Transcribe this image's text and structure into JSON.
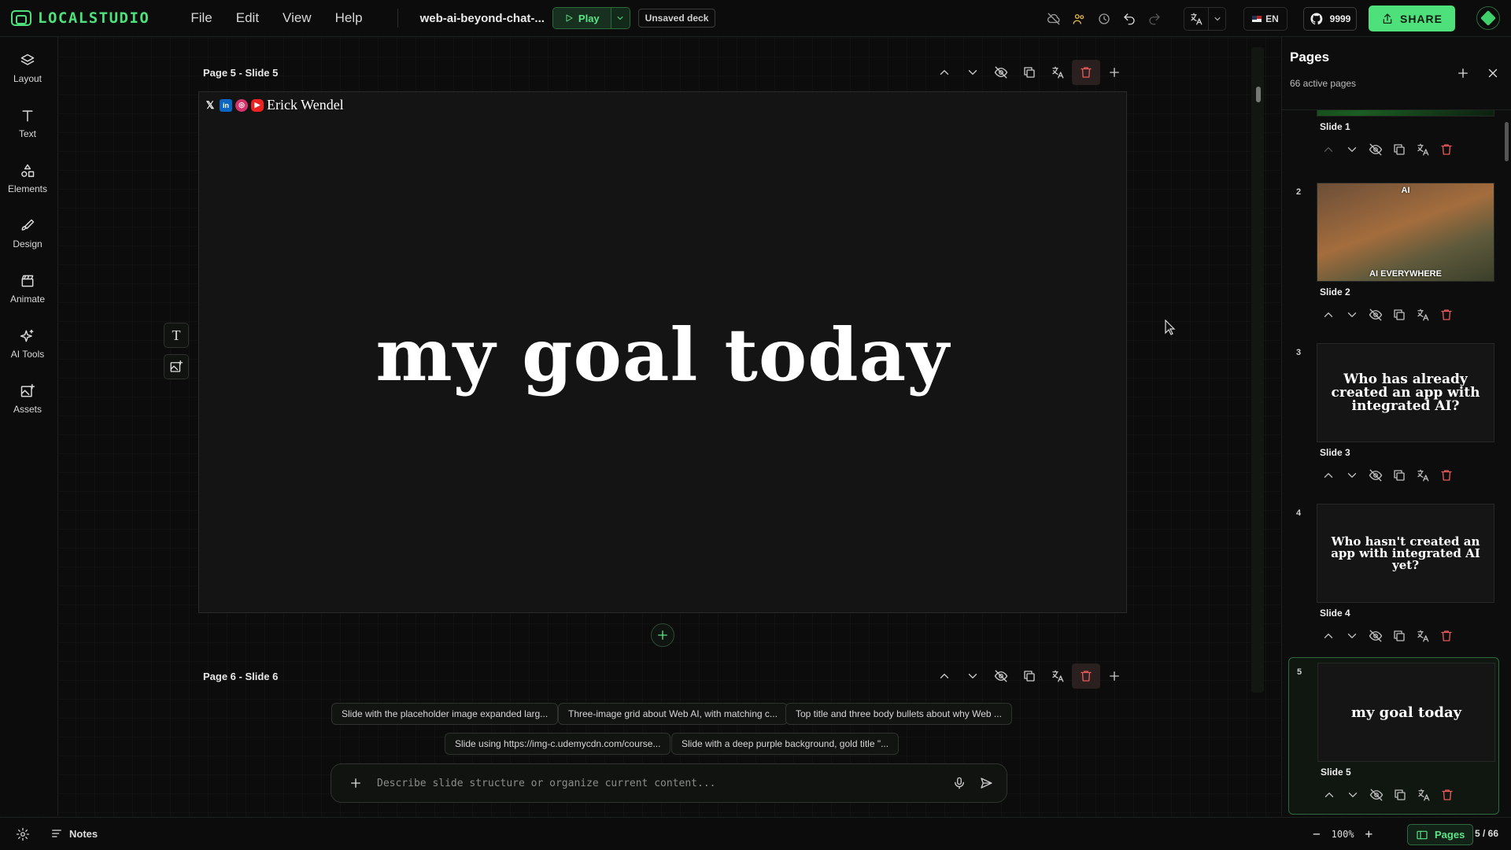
{
  "app": {
    "logo": "LOCALSTUDIO",
    "deck_name": "web-ai-beyond-chat-...",
    "play": "Play",
    "unsaved": "Unsaved deck",
    "lang": "EN",
    "github_count": "9999",
    "share": "SHARE",
    "accent": "#4ee07a"
  },
  "menu": [
    "File",
    "Edit",
    "View",
    "Help"
  ],
  "tools": [
    "Layout",
    "Text",
    "Elements",
    "Design",
    "Animate",
    "AI Tools",
    "Assets"
  ],
  "canvas": {
    "slide5_header": "Page 5 - Slide 5",
    "slide6_header": "Page 6 - Slide 6",
    "author": "Erick Wendel",
    "title": "my goal today"
  },
  "suggestions": [
    "Slide with the placeholder image expanded larg...",
    "Three-image grid about Web AI, with matching c...",
    "Top title and three body bullets about why Web ...",
    "Slide using https://img-c.udemycdn.com/course...",
    "Slide with a deep purple background, gold title \"..."
  ],
  "prompt": {
    "placeholder": "Describe slide structure or organize current content..."
  },
  "pages_panel": {
    "title": "Pages",
    "subtitle": "66 active pages",
    "pages": [
      {
        "num": "",
        "label": "Slide 1",
        "thumb": ""
      },
      {
        "num": "2",
        "label": "Slide 2",
        "thumb_top": "AI",
        "thumb_bottom": "AI EVERYWHERE"
      },
      {
        "num": "3",
        "label": "Slide 3",
        "thumb": "Who has already created an app with integrated AI?"
      },
      {
        "num": "4",
        "label": "Slide 4",
        "thumb": "Who hasn't created an app with integrated AI yet?"
      },
      {
        "num": "5",
        "label": "Slide 5",
        "thumb": "my goal today"
      }
    ]
  },
  "bottom": {
    "notes": "Notes",
    "zoom": "100%",
    "pages": "Pages",
    "count": "5 / 66"
  }
}
